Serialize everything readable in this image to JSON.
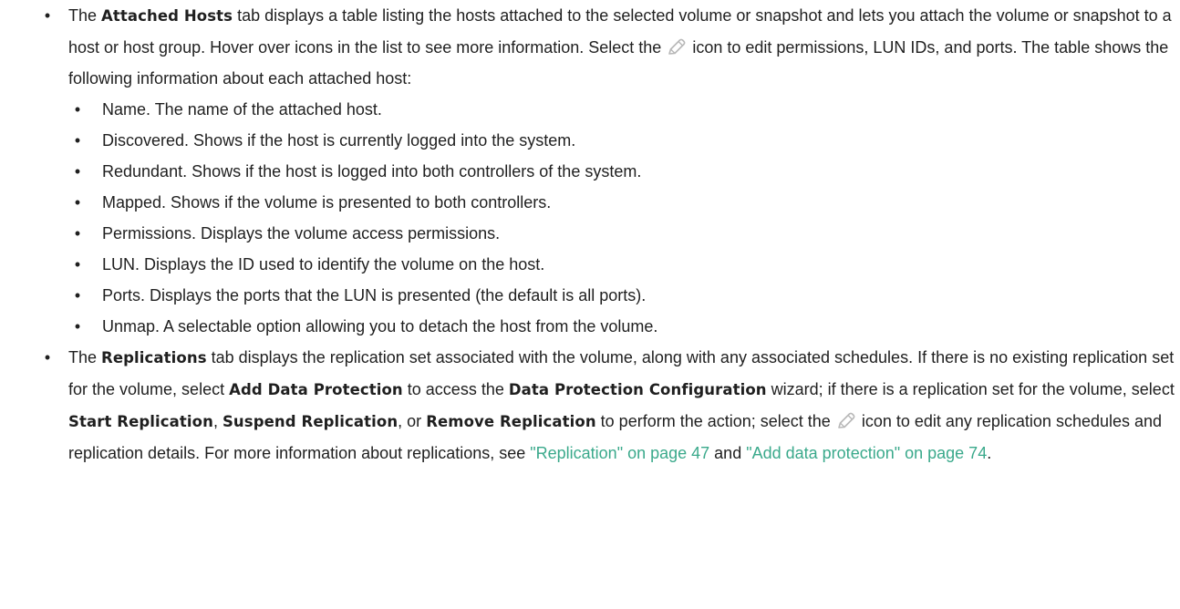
{
  "attached_hosts": {
    "intro_1": "The ",
    "tab_name": "Attached Hosts",
    "intro_2": " tab displays a table listing the hosts attached to the selected volume or snapshot and lets you attach the volume or snapshot to a host or host group. Hover over icons in the list to see more information. Select the ",
    "intro_3": " icon to edit permissions, LUN IDs, and ports. The table shows the following information about each attached host:",
    "items": [
      " Name. The name of the attached host.",
      "Discovered. Shows if the host is currently logged into the system.",
      "Redundant. Shows if the host is logged into both controllers of the system.",
      "Mapped. Shows if the volume is presented to both controllers.",
      "Permissions. Displays the volume access permissions.",
      "LUN. Displays the ID used to identify the volume on the host.",
      "Ports. Displays the ports that the LUN is presented (the default is all ports).",
      "Unmap. A selectable option allowing you to detach the host from the volume."
    ]
  },
  "replications": {
    "t1": "The ",
    "tab_name": "Replications",
    "t2": " tab displays the replication set associated with the volume, along with any associated schedules. If there is no existing replication set for the volume, select ",
    "add_data_protection": "Add Data Protection",
    "t3": " to access the ",
    "wizard_name": "Data Protection Configuration",
    "t4": " wizard; if there is a replication set for the volume, select ",
    "start_replication": "Start Replication",
    "t5": ", ",
    "suspend_replication": "Suspend Replication",
    "t6": ", or ",
    "remove_replication": "Remove Replication",
    "t7": " to perform the action; select the ",
    "t8": " icon to edit any replication schedules and replication details. For more information about replications, see ",
    "link_replication": "\"Replication\" on page 47",
    "t9": " and ",
    "link_add_data_protection": "\"Add data protection\" on page 74",
    "t10": "."
  },
  "icons": {
    "bullet": "•",
    "edit": "pencil-icon"
  },
  "colors": {
    "text": "#1f1f1f",
    "link": "#3aa98b",
    "icon": "#b8b8b8"
  }
}
